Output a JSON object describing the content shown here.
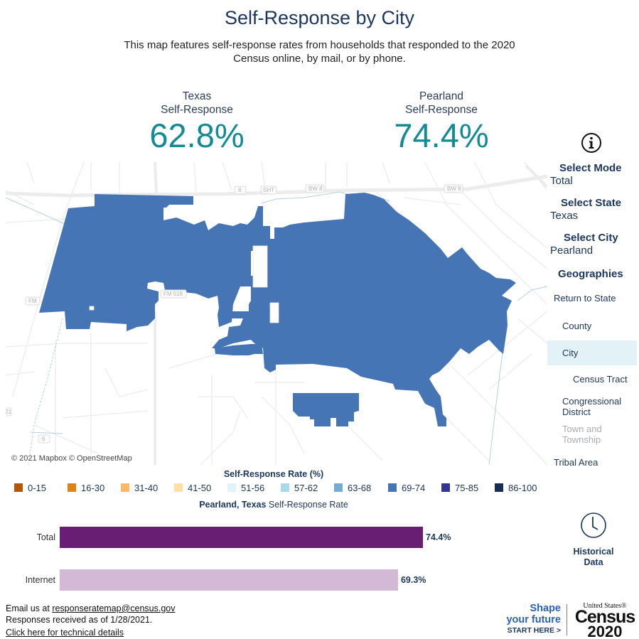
{
  "header": {
    "title": "Self-Response by City",
    "subtitle_line1": "This map features self-response rates from households that responded to the 2020",
    "subtitle_line2": "Census online, by mail, or by phone."
  },
  "kpis": {
    "state": {
      "line1": "Texas",
      "line2": "Self-Response",
      "value": "62.8%"
    },
    "city": {
      "line1": "Pearland",
      "line2": "Self-Response",
      "value": "74.4%"
    }
  },
  "map": {
    "attribution": "© 2021 Mapbox © OpenStreetMap",
    "fill_color": "#4575b4",
    "road_labels": [
      "8",
      "SHT",
      "BW 8",
      "BW 8",
      "FM",
      "FM 518",
      "21",
      "6"
    ],
    "selected_city": "Pearland",
    "selected_city_rate_bin": "69-74"
  },
  "sidebar": {
    "info_icon": "info-circle-icon",
    "select_mode": {
      "title": "Select Mode",
      "value": "Total"
    },
    "select_state": {
      "title": "Select State",
      "value": "Texas"
    },
    "select_city": {
      "title": "Select City",
      "value": "Pearland"
    },
    "geographies": {
      "title": "Geographies",
      "items": [
        {
          "label": "Return to State",
          "state": "normal"
        },
        {
          "label": "County",
          "state": "normal"
        },
        {
          "label": "City",
          "state": "active"
        },
        {
          "label": "Census Tract",
          "state": "normal"
        },
        {
          "label": "Congressional District",
          "state": "normal"
        },
        {
          "label": "Town and Township",
          "state": "disabled"
        },
        {
          "label": "Tribal Area",
          "state": "normal"
        }
      ]
    },
    "historical": {
      "label_line1": "Historical",
      "label_line2": "Data",
      "icon": "clock-icon"
    }
  },
  "legend": {
    "title": "Self-Response Rate (%)",
    "items": [
      {
        "label": "0-15",
        "color": "#b35806"
      },
      {
        "label": "16-30",
        "color": "#e08214"
      },
      {
        "label": "31-40",
        "color": "#fdb863"
      },
      {
        "label": "41-50",
        "color": "#fee0a0"
      },
      {
        "label": "51-56",
        "color": "#e0f3f8"
      },
      {
        "label": "57-62",
        "color": "#abd9e9"
      },
      {
        "label": "63-68",
        "color": "#74add1"
      },
      {
        "label": "69-74",
        "color": "#4575b4"
      },
      {
        "label": "75-85",
        "color": "#313695"
      },
      {
        "label": "86-100",
        "color": "#172e52"
      }
    ]
  },
  "chart_data": {
    "type": "bar",
    "orientation": "horizontal",
    "title_bold": "Pearland, Texas",
    "title_rest": " Self-Response Rate",
    "categories": [
      "Total",
      "Internet"
    ],
    "values": [
      74.4,
      69.3
    ],
    "value_labels": [
      "74.4%",
      "69.3%"
    ],
    "colors": [
      "#681e72",
      "#d3b9d6"
    ],
    "xlim": [
      0,
      80
    ]
  },
  "footer": {
    "email_prefix": "Email us at ",
    "email_link": "responseratemap@census.gov",
    "received": "Responses received as of 1/28/2021.",
    "tech_link": "Click here for technical details"
  },
  "branding": {
    "shape_line1": "Shape",
    "shape_line2": "your future",
    "shape_line3": "START HERE >",
    "census_top": "United States®",
    "census_word": "Census",
    "census_year": "2020"
  }
}
